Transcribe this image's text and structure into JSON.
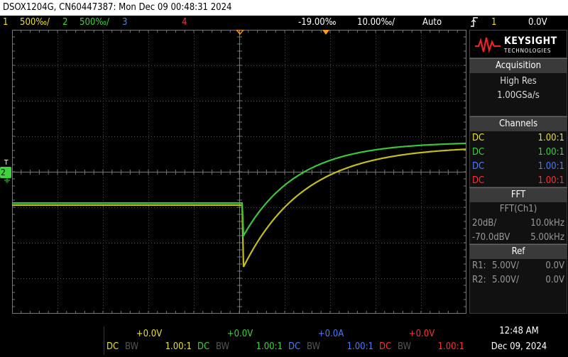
{
  "title": "DSOX1204G, CN60447387: Mon Dec 09 00:48:31 2024",
  "status": {
    "ch1_num": "1",
    "ch1_scale": "500‰/",
    "ch2_num": "2",
    "ch2_scale": "500‰/",
    "ch3_num": "3",
    "ch4_num": "4",
    "time_delay": "-19.00‰",
    "time_scale": "10.00‰/",
    "run_mode": "Auto",
    "trigger_icon": "trigger-edge-rising-icon",
    "trigger_source": "1",
    "trigger_level": "0.0V"
  },
  "brand": {
    "name": "KEYSIGHT",
    "sub": "TECHNOLOGIES"
  },
  "acquisition": {
    "header": "Acquisition",
    "mode": "High Res",
    "rate": "1.00GSa/s"
  },
  "channels": {
    "header": "Channels",
    "items": [
      {
        "coupling": "DC",
        "probe": "1.00:1",
        "color": "#e8e030"
      },
      {
        "coupling": "DC",
        "probe": "1.00:1",
        "color": "#3cd43c"
      },
      {
        "coupling": "DC",
        "probe": "1.00:1",
        "color": "#4a7bff"
      },
      {
        "coupling": "DC",
        "probe": "1.00:1",
        "color": "#ff3030"
      }
    ]
  },
  "fft": {
    "header": "FFT",
    "source": "FFT(Ch1)",
    "vscale": "20dB/",
    "span": "10.0kHz",
    "ref": "-70.0dBV",
    "center": "5.00kHz"
  },
  "ref": {
    "header": "Ref",
    "r1_label": "R1:",
    "r1_scale": "5.00V/",
    "r1_offset": "0.0V",
    "r2_label": "R2:",
    "r2_scale": "5.00V/",
    "r2_offset": "0.0V"
  },
  "bottom": {
    "channels": [
      {
        "offset": "+0.0V",
        "coupling": "DC",
        "bw": "BW",
        "probe": "1.00:1",
        "color": "#e8e030"
      },
      {
        "offset": "+0.0V",
        "coupling": "DC",
        "bw": "BW",
        "probe": "1.00:1",
        "color": "#3cd43c"
      },
      {
        "offset": "+0.0A",
        "coupling": "DC",
        "bw": "BW",
        "probe": "1.00:1",
        "color": "#4a7bff"
      },
      {
        "offset": "+0.0V",
        "coupling": "DC",
        "bw": "BW",
        "probe": "1.00:1",
        "color": "#ff3030"
      }
    ],
    "time": "12:48 AM",
    "date": "Dec 09, 2024"
  },
  "markers": {
    "ground_label": "2",
    "trigger_level_label": "T"
  },
  "colors": {
    "ch1": "#e8e030",
    "ch2": "#3cd43c",
    "ch3": "#4a7bff",
    "ch4": "#ff3030",
    "trigger": "#ff9a1a"
  }
}
